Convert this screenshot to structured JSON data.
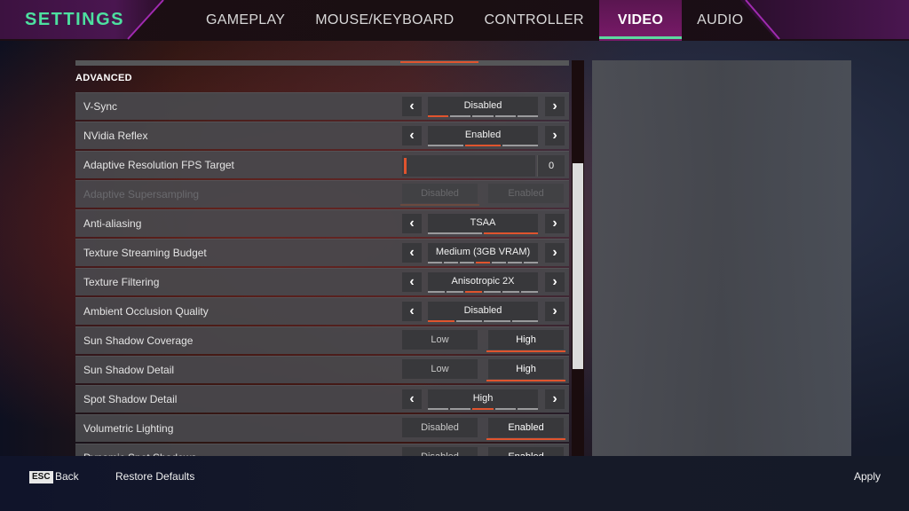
{
  "header": {
    "title": "SETTINGS",
    "tabs": [
      {
        "label": "GAMEPLAY",
        "active": false
      },
      {
        "label": "MOUSE/KEYBOARD",
        "active": false
      },
      {
        "label": "CONTROLLER",
        "active": false
      },
      {
        "label": "VIDEO",
        "active": true
      },
      {
        "label": "AUDIO",
        "active": false
      }
    ]
  },
  "section": {
    "title": "ADVANCED"
  },
  "settings": [
    {
      "label": "V-Sync",
      "type": "carousel",
      "value": "Disabled",
      "option_count": 5,
      "selected_index": 0,
      "enabled": true
    },
    {
      "label": "NVidia Reflex",
      "type": "carousel",
      "value": "Enabled",
      "option_count": 3,
      "selected_index": 1,
      "enabled": true
    },
    {
      "label": "Adaptive Resolution FPS Target",
      "type": "slider",
      "value": "0",
      "fraction": 0,
      "enabled": true
    },
    {
      "label": "Adaptive Supersampling",
      "type": "toggle",
      "options": [
        "Disabled",
        "Enabled"
      ],
      "selected_index": 0,
      "enabled": false
    },
    {
      "label": "Anti-aliasing",
      "type": "carousel",
      "value": "TSAA",
      "option_count": 2,
      "selected_index": 1,
      "enabled": true
    },
    {
      "label": "Texture Streaming Budget",
      "type": "carousel",
      "value": "Medium (3GB VRAM)",
      "option_count": 7,
      "selected_index": 3,
      "enabled": true
    },
    {
      "label": "Texture Filtering",
      "type": "carousel",
      "value": "Anisotropic 2X",
      "option_count": 6,
      "selected_index": 2,
      "enabled": true
    },
    {
      "label": "Ambient Occlusion Quality",
      "type": "carousel",
      "value": "Disabled",
      "option_count": 4,
      "selected_index": 0,
      "enabled": true
    },
    {
      "label": "Sun Shadow Coverage",
      "type": "toggle",
      "options": [
        "Low",
        "High"
      ],
      "selected_index": 1,
      "enabled": true
    },
    {
      "label": "Sun Shadow Detail",
      "type": "toggle",
      "options": [
        "Low",
        "High"
      ],
      "selected_index": 1,
      "enabled": true
    },
    {
      "label": "Spot Shadow Detail",
      "type": "carousel",
      "value": "High",
      "option_count": 5,
      "selected_index": 2,
      "enabled": true
    },
    {
      "label": "Volumetric Lighting",
      "type": "toggle",
      "options": [
        "Disabled",
        "Enabled"
      ],
      "selected_index": 1,
      "enabled": true
    },
    {
      "label": "Dynamic Spot Shadows",
      "type": "toggle",
      "options": [
        "Disabled",
        "Enabled"
      ],
      "selected_index": 1,
      "enabled": true
    }
  ],
  "scroll": {
    "thumb_start_fraction": 0.26,
    "thumb_size_fraction": 0.52
  },
  "footer": {
    "esc_key": "ESC",
    "back_label": "Back",
    "restore_label": "Restore Defaults",
    "apply_label": "Apply"
  },
  "icons": {
    "arrow_left": "‹",
    "arrow_right": "›"
  }
}
